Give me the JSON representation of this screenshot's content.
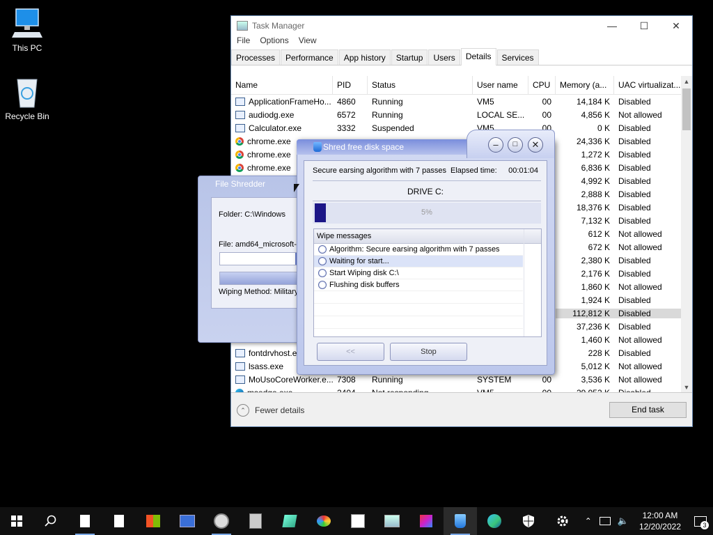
{
  "desktop": {
    "icons": [
      {
        "label": "This PC",
        "icon": "monitor-icon"
      },
      {
        "label": "Recycle Bin",
        "icon": "recycle-bin-icon"
      }
    ]
  },
  "task_manager": {
    "title": "Task Manager",
    "menu": [
      "File",
      "Options",
      "View"
    ],
    "tabs": [
      "Processes",
      "Performance",
      "App history",
      "Startup",
      "Users",
      "Details",
      "Services"
    ],
    "active_tab": "Details",
    "columns": [
      "Name",
      "PID",
      "Status",
      "User name",
      "CPU",
      "Memory (a...",
      "UAC virtualizat..."
    ],
    "rows": [
      {
        "name": "ApplicationFrameHo...",
        "pid": "4860",
        "status": "Running",
        "user": "VM5",
        "cpu": "00",
        "mem": "14,184 K",
        "uac": "Disabled",
        "icon": "app-icon"
      },
      {
        "name": "audiodg.exe",
        "pid": "6572",
        "status": "Running",
        "user": "LOCAL SE...",
        "cpu": "00",
        "mem": "4,856 K",
        "uac": "Not allowed",
        "icon": "app-icon"
      },
      {
        "name": "Calculator.exe",
        "pid": "3332",
        "status": "Suspended",
        "user": "VM5",
        "cpu": "00",
        "mem": "0 K",
        "uac": "Disabled",
        "icon": "app-icon"
      },
      {
        "name": "chrome.exe",
        "pid": "",
        "status": "",
        "user": "",
        "cpu": "",
        "mem": "24,336 K",
        "uac": "Disabled",
        "icon": "chrome-icon"
      },
      {
        "name": "chrome.exe",
        "pid": "",
        "status": "",
        "user": "",
        "cpu": "",
        "mem": "1,272 K",
        "uac": "Disabled",
        "icon": "chrome-icon"
      },
      {
        "name": "chrome.exe",
        "pid": "",
        "status": "",
        "user": "",
        "cpu": "",
        "mem": "6,836 K",
        "uac": "Disabled",
        "icon": "chrome-icon"
      },
      {
        "name": "",
        "pid": "",
        "status": "",
        "user": "",
        "cpu": "",
        "mem": "4,992 K",
        "uac": "Disabled",
        "icon": ""
      },
      {
        "name": "",
        "pid": "",
        "status": "",
        "user": "",
        "cpu": "",
        "mem": "2,888 K",
        "uac": "Disabled",
        "icon": ""
      },
      {
        "name": "",
        "pid": "",
        "status": "",
        "user": "",
        "cpu": "",
        "mem": "18,376 K",
        "uac": "Disabled",
        "icon": ""
      },
      {
        "name": "",
        "pid": "",
        "status": "",
        "user": "",
        "cpu": "",
        "mem": "7,132 K",
        "uac": "Disabled",
        "icon": ""
      },
      {
        "name": "",
        "pid": "",
        "status": "",
        "user": "",
        "cpu": "",
        "mem": "612 K",
        "uac": "Not allowed",
        "icon": ""
      },
      {
        "name": "",
        "pid": "",
        "status": "",
        "user": "",
        "cpu": "",
        "mem": "672 K",
        "uac": "Not allowed",
        "icon": ""
      },
      {
        "name": "",
        "pid": "",
        "status": "",
        "user": "",
        "cpu": "",
        "mem": "2,380 K",
        "uac": "Disabled",
        "icon": ""
      },
      {
        "name": "",
        "pid": "",
        "status": "",
        "user": "",
        "cpu": "",
        "mem": "2,176 K",
        "uac": "Disabled",
        "icon": ""
      },
      {
        "name": "",
        "pid": "",
        "status": "",
        "user": "",
        "cpu": "",
        "mem": "1,860 K",
        "uac": "Not allowed",
        "icon": ""
      },
      {
        "name": "",
        "pid": "",
        "status": "",
        "user": "",
        "cpu": "",
        "mem": "1,924 K",
        "uac": "Disabled",
        "icon": ""
      },
      {
        "name": "",
        "pid": "",
        "status": "",
        "user": "",
        "cpu": "",
        "mem": "112,812 K",
        "uac": "Disabled",
        "icon": "",
        "selected": true
      },
      {
        "name": "",
        "pid": "",
        "status": "",
        "user": "",
        "cpu": "",
        "mem": "37,236 K",
        "uac": "Disabled",
        "icon": ""
      },
      {
        "name": "",
        "pid": "",
        "status": "",
        "user": "",
        "cpu": "",
        "mem": "1,460 K",
        "uac": "Not allowed",
        "icon": ""
      },
      {
        "name": "fontdrvhost.e...",
        "pid": "",
        "status": "",
        "user": "",
        "cpu": "",
        "mem": "228 K",
        "uac": "Disabled",
        "icon": "app-icon"
      },
      {
        "name": "lsass.exe",
        "pid": "",
        "status": "",
        "user": "",
        "cpu": "",
        "mem": "5,012 K",
        "uac": "Not allowed",
        "icon": "app-icon"
      },
      {
        "name": "MoUsoCoreWorker.e...",
        "pid": "7308",
        "status": "Running",
        "user": "SYSTEM",
        "cpu": "00",
        "mem": "3,536 K",
        "uac": "Not allowed",
        "icon": "app-icon"
      },
      {
        "name": "msedge.exe",
        "pid": "2404",
        "status": "Not responding",
        "user": "VM5",
        "cpu": "00",
        "mem": "29,952 K",
        "uac": "Disabled",
        "icon": "edge-icon"
      }
    ],
    "fewer_details": "Fewer details",
    "end_task": "End task"
  },
  "file_shredder": {
    "title": "File Shredder",
    "folder": "Folder: C:\\Windows",
    "file": "File: amd64_microsoft-",
    "wiping_method": "Wiping Method: Military"
  },
  "shred_dialog": {
    "title": "Shred free disk space",
    "algorithm_line": "Secure earsing algorithm with 7 passes",
    "elapsed_label": "Elapsed time:",
    "elapsed_value": "00:01:04",
    "drive": "DRIVE C:",
    "progress_percent": 5,
    "progress_text": "5%",
    "messages_header": "Wipe messages",
    "messages": [
      "Algorithm: Secure earsing algorithm with 7 passes",
      "Waiting for start...",
      "Start Wiping disk C:\\",
      "Flushing disk buffers"
    ],
    "back_button": "<<",
    "stop_button": "Stop"
  },
  "taskbar": {
    "time": "12:00 AM",
    "date": "12/20/2022",
    "notifications": "3"
  }
}
